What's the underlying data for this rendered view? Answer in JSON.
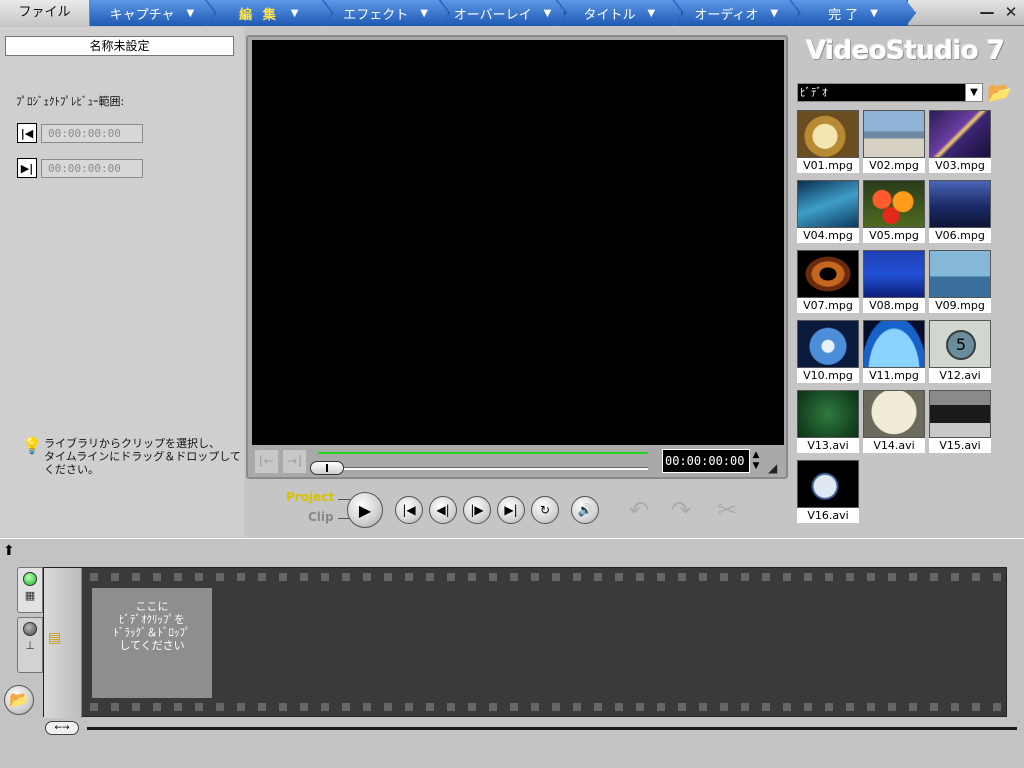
{
  "file_menu": "ファイル",
  "steps": [
    {
      "label": "キャプチャ",
      "active": false
    },
    {
      "label": "編 集",
      "active": true
    },
    {
      "label": "エフェクト",
      "active": false
    },
    {
      "label": "オーバーレイ",
      "active": false
    },
    {
      "label": "タイトル",
      "active": false
    },
    {
      "label": "オーディオ",
      "active": false
    },
    {
      "label": "完 了",
      "active": false
    }
  ],
  "window": {
    "minimize": "—",
    "close": "✕"
  },
  "options": {
    "project_name": "名称未設定",
    "range_title": "ﾌﾟﾛｼﾞｪｸﾄﾌﾟﾚﾋﾞｭｰ範囲:",
    "mark_in_tc": "00:00:00:00",
    "mark_out_tc": "00:00:00:00",
    "hint": "ライブラリからクリップを選択し、\nタイムラインにドラッグ＆ドロップして\nください。"
  },
  "preview": {
    "timecode": "00:00:00:00"
  },
  "playback": {
    "project_label": "Project",
    "clip_label": "Clip"
  },
  "library": {
    "logo": "VideoStudio 7",
    "category": "ﾋﾞﾃﾞｵ",
    "clips": [
      {
        "name": "V01.mpg",
        "thumb": "th1"
      },
      {
        "name": "V02.mpg",
        "thumb": "th2"
      },
      {
        "name": "V03.mpg",
        "thumb": "th3"
      },
      {
        "name": "V04.mpg",
        "thumb": "th4"
      },
      {
        "name": "V05.mpg",
        "thumb": "th5"
      },
      {
        "name": "V06.mpg",
        "thumb": "th6"
      },
      {
        "name": "V07.mpg",
        "thumb": "th7"
      },
      {
        "name": "V08.mpg",
        "thumb": "th8"
      },
      {
        "name": "V09.mpg",
        "thumb": "th9"
      },
      {
        "name": "V10.mpg",
        "thumb": "th10"
      },
      {
        "name": "V11.mpg",
        "thumb": "th11"
      },
      {
        "name": "V12.avi",
        "thumb": "th12",
        "overlay": "5"
      },
      {
        "name": "V13.avi",
        "thumb": "th13"
      },
      {
        "name": "V14.avi",
        "thumb": "th14"
      },
      {
        "name": "V15.avi",
        "thumb": "th15"
      },
      {
        "name": "V16.avi",
        "thumb": "th16"
      }
    ]
  },
  "timeline": {
    "drop_hint": "ここに\nﾋﾞﾃﾞｵｸﾘｯﾌﾟを\nﾄﾞﾗｯｸﾞ＆ﾄﾞﾛｯﾌﾟ\nしてください"
  }
}
